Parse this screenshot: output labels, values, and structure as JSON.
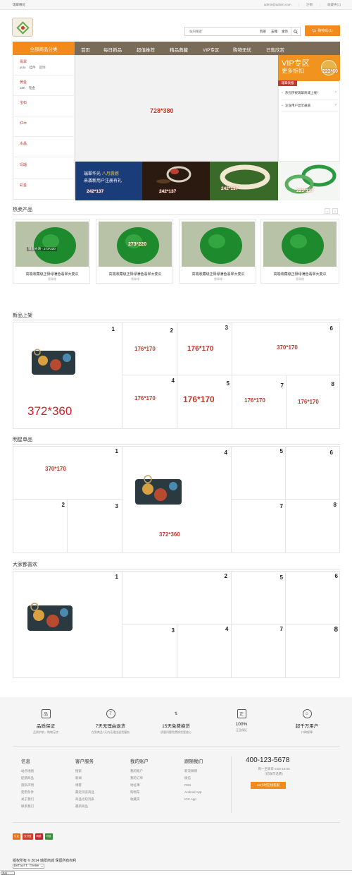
{
  "topbar": {
    "site_name": "瑞翠缘化",
    "user": "admin@admin.com",
    "logout": "注销",
    "cart": "收藏夹(1)"
  },
  "search": {
    "placeholder": "站内搜索",
    "hot": [
      "翡翠",
      "玉镯",
      "金饰"
    ],
    "cart_label": "购物车(1)"
  },
  "nav": {
    "all_categories": "全部商品分类",
    "items": [
      "首页",
      "每日新品",
      "超值推荐",
      "精品典藏",
      "VIP专区",
      "购物无忧",
      "已售欣赏"
    ]
  },
  "categories": [
    {
      "name": "翡翠",
      "subs": [
        "yutu",
        "挂件",
        "首饰"
      ]
    },
    {
      "name": "黄金",
      "subs": [
        "18K",
        "铂金"
      ]
    },
    {
      "name": "宝石",
      "subs": []
    },
    {
      "name": "红木",
      "subs": []
    },
    {
      "name": "水晶",
      "subs": []
    },
    {
      "name": "玛瑙",
      "subs": []
    },
    {
      "name": "彩金",
      "subs": []
    }
  ],
  "banner": {
    "size": "728*380"
  },
  "vip": {
    "title": "VIP专区",
    "subtitle": "更多折扣",
    "size": "223*60"
  },
  "news": {
    "tag": "瑞翠快报",
    "items": [
      "热烈庆祝瑞翠商城上线！",
      "企业用户显示通道"
    ]
  },
  "thumbs": [
    {
      "size": "242*137",
      "text1": "瑞翠华光",
      "text2": "八月震撼",
      "text3": "来袭新用户注册有礼"
    },
    {
      "size": "242*137"
    },
    {
      "size": "242*137"
    },
    {
      "size": "223*137"
    }
  ],
  "hot": {
    "title": "热卖产品",
    "pager": [
      "‹",
      "›"
    ],
    "image_size": "273*220",
    "image_caption": "镜面光滑 · 273*220",
    "products": [
      {
        "name": "高端收藏级正阳绿满色翡翠大麦瓜",
        "sub": "翡翠缘"
      },
      {
        "name": "高端收藏级正阳绿满色翡翠大麦瓜",
        "sub": "翡翠缘"
      },
      {
        "name": "高端收藏级正阳绿满色翡翠大麦瓜",
        "sub": "翡翠缘"
      },
      {
        "name": "高端收藏级正阳绿满色翡翠大麦瓜",
        "sub": "翡翠缘"
      }
    ]
  },
  "new_arrivals": {
    "title": "新品上架",
    "big_size": "372*360",
    "cells": [
      {
        "num": "1"
      },
      {
        "num": "2",
        "size": "176*170"
      },
      {
        "num": "3",
        "size": "176*170"
      },
      {
        "num": "6",
        "size": "370*170"
      },
      {
        "num": "4",
        "size": "176*170"
      },
      {
        "num": "5",
        "size": "176*170"
      },
      {
        "num": "7",
        "size": "176*170"
      },
      {
        "num": "8",
        "size": "176*170"
      }
    ]
  },
  "star": {
    "title": "明星单品",
    "wide_size": "370*170",
    "center_size": "372*360",
    "nums": [
      "1",
      "4",
      "5",
      "6",
      "2",
      "3",
      "7",
      "8"
    ]
  },
  "popular": {
    "title": "大家都喜欢",
    "nums": [
      "1",
      "2",
      "5",
      "6",
      "3",
      "4",
      "7",
      "8"
    ]
  },
  "features": [
    {
      "icon": "quality-icon",
      "glyph": "品",
      "title": "品质保证",
      "desc": "品质护航，购物无忧"
    },
    {
      "icon": "return-icon",
      "glyph": "7",
      "title": "7天无理由退货",
      "desc": "在到商品7天内无理由退货服务"
    },
    {
      "icon": "exchange-icon",
      "glyph": "⇅",
      "title": "15天免费换货",
      "desc": "质量问题免费换货更放心"
    },
    {
      "icon": "genuine-icon",
      "glyph": "正",
      "title": "100%",
      "desc": "正品保证"
    },
    {
      "icon": "users-icon",
      "glyph": "☺",
      "title": "超千万用户",
      "desc": "口碑保障"
    }
  ],
  "footer_cols": [
    {
      "title": "信息",
      "links": [
        "站点地图",
        "促销商品",
        "隐私声明",
        "使用条件",
        "关于我们",
        "联系我们"
      ]
    },
    {
      "title": "客户服务",
      "links": [
        "搜索",
        "新闻",
        "博客",
        "最近浏览商品",
        "商品比较列表",
        "最新商品"
      ]
    },
    {
      "title": "我的账户",
      "links": [
        "我的账户",
        "我的订单",
        "地址簿",
        "购物车",
        "收藏夹"
      ]
    },
    {
      "title": "跟随我们",
      "links": [
        "新浪微博",
        "微信",
        "RSS",
        "Android App",
        "IOS App"
      ]
    }
  ],
  "contact": {
    "phone": "400-123-5678",
    "hours": "周一至周日 8:00-18:00",
    "hours2": "（仅收市话费）",
    "button": "24小时在线客服"
  },
  "badges": [
    {
      "label": "认证",
      "color": "#e8731c"
    },
    {
      "label": "支付宝",
      "color": "#d33c2e"
    },
    {
      "label": "网银",
      "color": "#c8202a"
    },
    {
      "label": "可信",
      "color": "#3d8b3d"
    }
  ],
  "copyright": "版权所有 © 2014 瑞翠商城 保留所有权利",
  "theme_select": "Default Theme",
  "bottom_button": "关闭"
}
